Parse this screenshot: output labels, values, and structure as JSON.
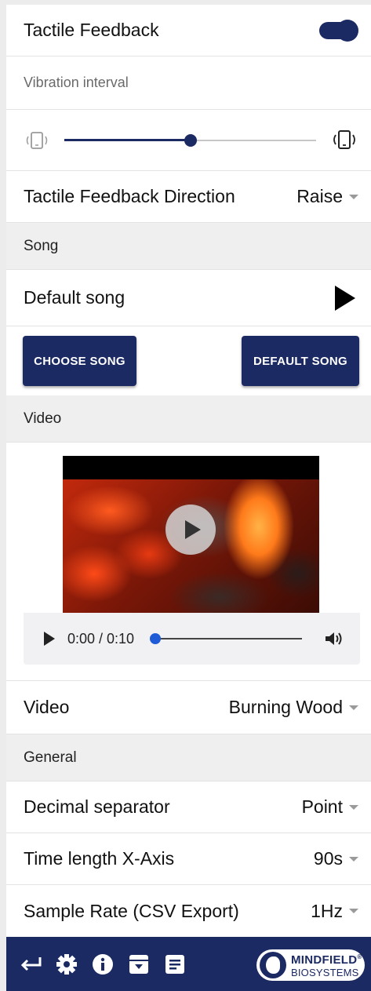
{
  "tactile": {
    "title": "Tactile Feedback",
    "enabled": true,
    "interval_label": "Vibration interval",
    "interval_value": 0.5,
    "direction_label": "Tactile Feedback Direction",
    "direction_value": "Raise"
  },
  "song": {
    "section_label": "Song",
    "current_song": "Default song",
    "choose_button": "CHOOSE SONG",
    "default_button": "DEFAULT SONG"
  },
  "video": {
    "section_label": "Video",
    "time": "0:00 / 0:10",
    "progress": 0,
    "select_label": "Video",
    "select_value": "Burning Wood"
  },
  "general": {
    "section_label": "General",
    "decimal_label": "Decimal separator",
    "decimal_value": "Point",
    "timelength_label": "Time length X-Axis",
    "timelength_value": "90s",
    "samplerate_label": "Sample Rate (CSV Export)",
    "samplerate_value": "1Hz"
  },
  "footer": {
    "logo_line1": "MINDFIELD",
    "logo_reg": "®",
    "logo_line2": "BIOSYSTEMS",
    "icons": [
      "back-arrow-icon",
      "gear-icon",
      "info-icon",
      "archive-icon",
      "notes-icon"
    ]
  },
  "colors": {
    "primary": "#1c2a63",
    "section_bg": "#efefef",
    "media_accent": "#1f5bd6"
  }
}
